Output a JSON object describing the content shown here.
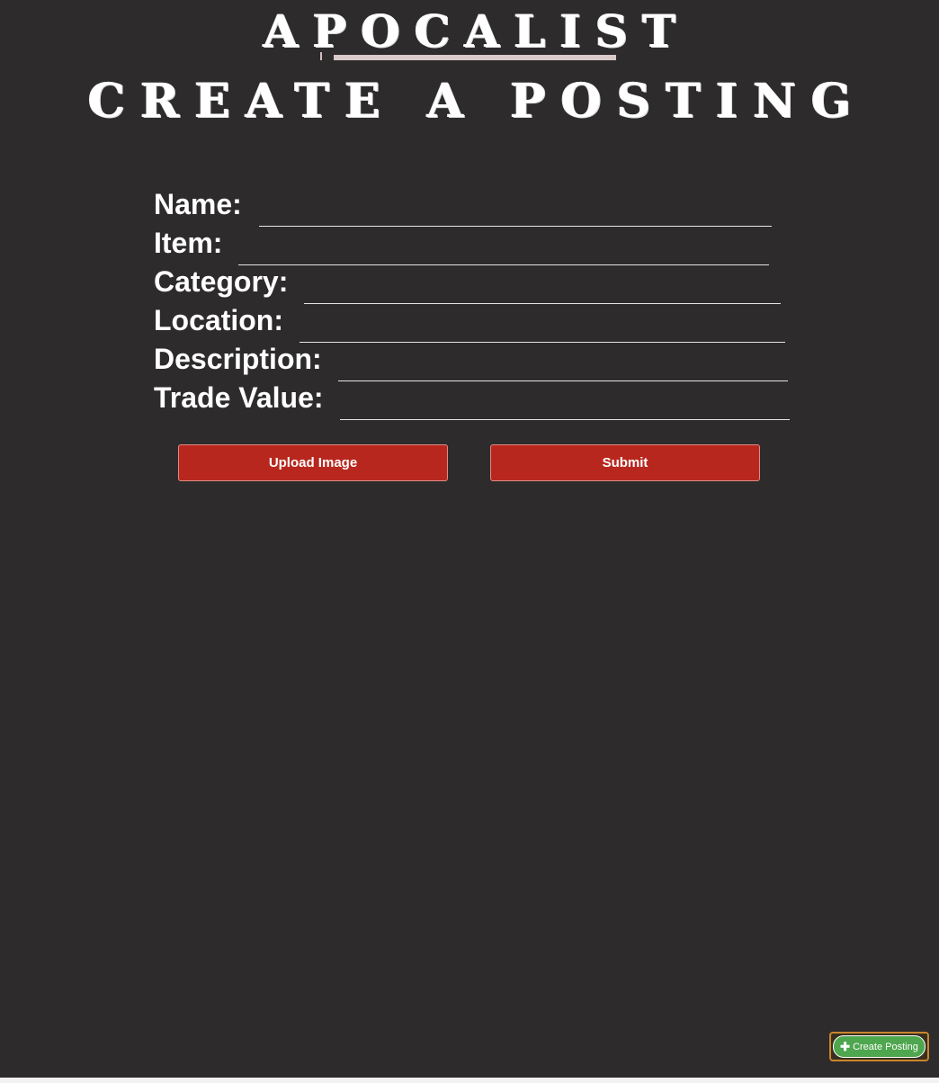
{
  "header": {
    "brand": "APOCALIST",
    "title": "CREATE A POSTING"
  },
  "form": {
    "fields": [
      {
        "label": "Name:",
        "value": ""
      },
      {
        "label": "Item:",
        "value": ""
      },
      {
        "label": "Category:",
        "value": ""
      },
      {
        "label": "Location:",
        "value": ""
      },
      {
        "label": "Description:",
        "value": ""
      },
      {
        "label": "Trade Value:",
        "value": ""
      }
    ],
    "upload_label": "Upload Image",
    "submit_label": "Submit"
  },
  "fab": {
    "icon": "plus-icon",
    "label": "Create Posting"
  },
  "colors": {
    "background": "#2d2b2c",
    "button": "#b8271e",
    "fab": "#4ea64e",
    "fab_border": "#c9862f"
  }
}
